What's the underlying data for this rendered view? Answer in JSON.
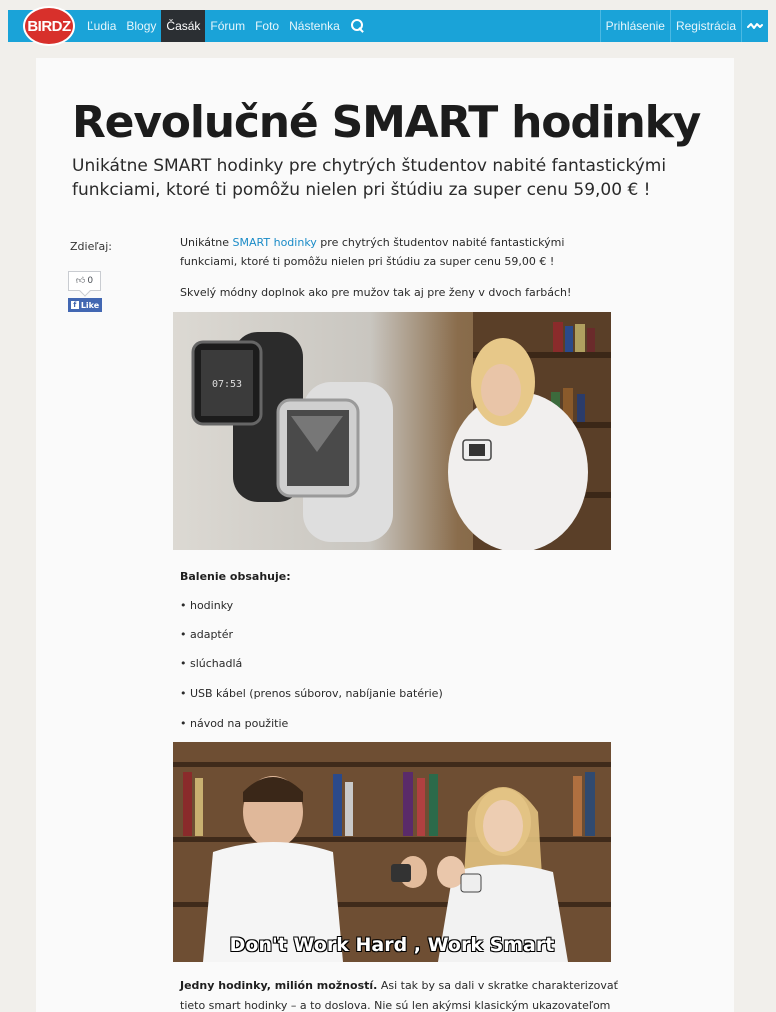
{
  "navbar": {
    "logo": "BIRDZ",
    "items": [
      "Ľudia",
      "Blogy",
      "Časák",
      "Fórum",
      "Foto",
      "Nástenka"
    ],
    "active_item": "Časák",
    "right_items": [
      "Prihlásenie",
      "Registrácia"
    ],
    "accent": "#1aa3d8",
    "logo_color": "#d8302b"
  },
  "article": {
    "title": "Revolučné SMART hodinky",
    "subtitle": "Unikátne SMART hodinky pre chytrých študentov nabité fantastickými funkciami, ktoré ti pomôžu nielen pri štúdiu za super cenu 59,00 € !",
    "share_label": "Zdieľaj:",
    "like_count": "0",
    "fb_like_label": "Like",
    "intro_before_link": "Unikátne ",
    "intro_link": "SMART hodinky",
    "intro_after_link": " pre chytrých študentov nabité fantastickými funkciami, ktoré ti pomôžu nielen pri štúdiu za super cenu 59,00 € !",
    "paragraph2": "Skvelý módny doplnok ako pre mužov tak aj pre ženy v dvoch farbách!",
    "package_heading": "Balenie obsahuje:",
    "package_items": [
      "• hodinky",
      "• adaptér",
      "• slúchadlá",
      "• USB kábel (prenos súborov, nabíjanie batérie)",
      "• návod na použitie"
    ],
    "image2_caption": "Don't Work Hard , Work Smart",
    "closing_bold": "Jedny hodinky, milión možností.",
    "closing_text": " Asi tak by sa dali v skratke charakterizovať tieto smart hodinky – a to doslova. Nie sú len akýmsi klasickým ukazovateľom"
  }
}
